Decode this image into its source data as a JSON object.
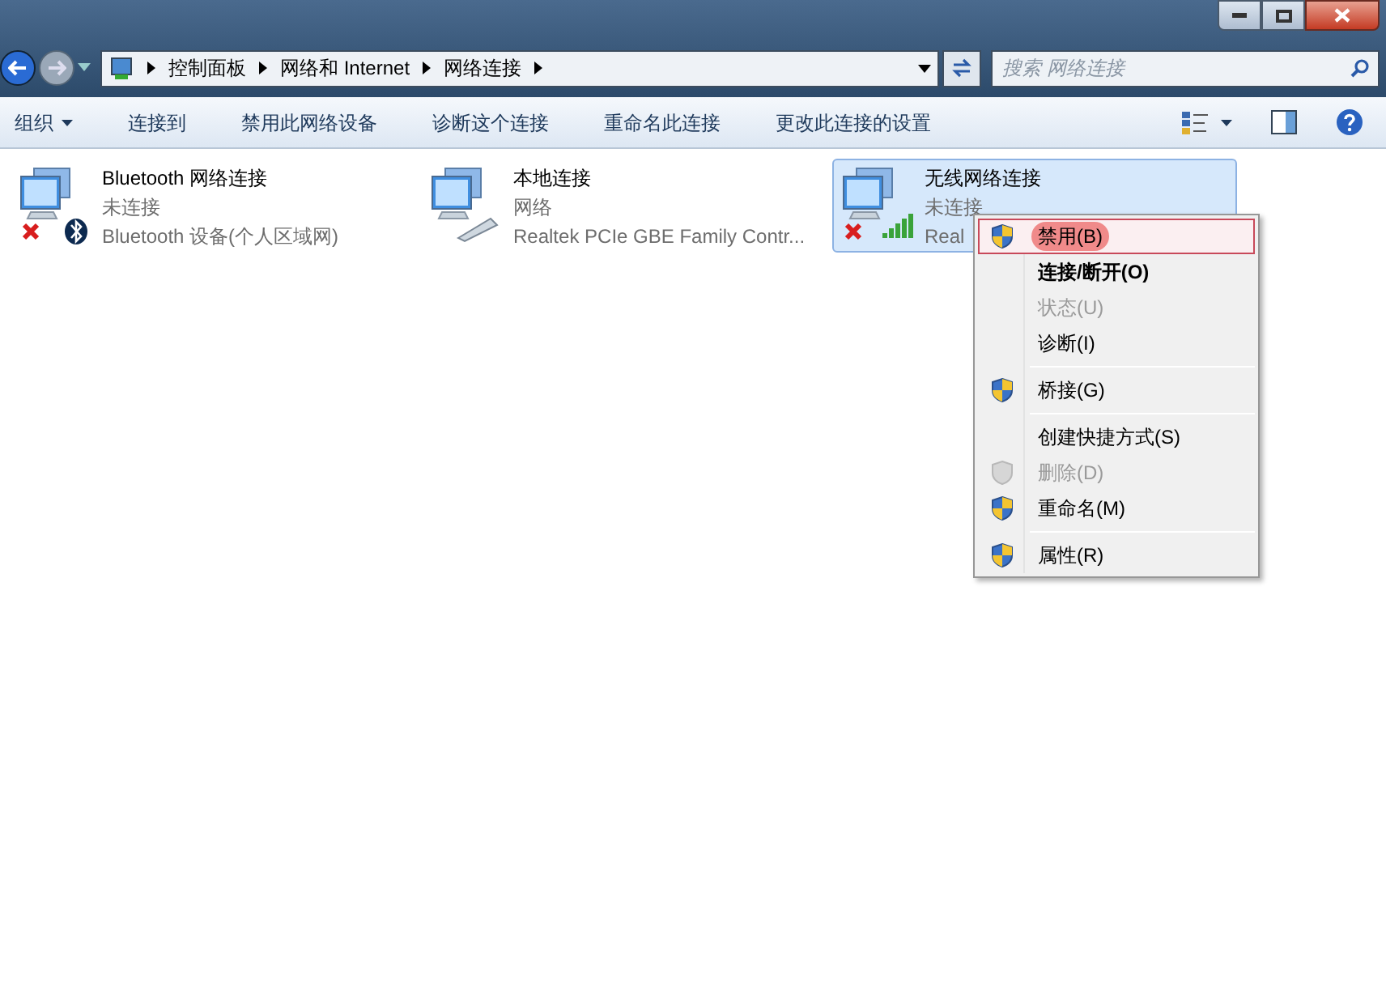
{
  "address_bar": {
    "breadcrumbs": [
      "控制面板",
      "网络和 Internet",
      "网络连接"
    ]
  },
  "search": {
    "placeholder": "搜索 网络连接"
  },
  "toolbar": {
    "items": [
      {
        "label": "组织",
        "dropdown": true
      },
      {
        "label": "连接到",
        "dropdown": false
      },
      {
        "label": "禁用此网络设备",
        "dropdown": false
      },
      {
        "label": "诊断这个连接",
        "dropdown": false
      },
      {
        "label": "重命名此连接",
        "dropdown": false
      },
      {
        "label": "更改此连接的设置",
        "dropdown": false
      }
    ]
  },
  "connections": [
    {
      "kind": "bluetooth",
      "name": "Bluetooth 网络连接",
      "status": "未连接",
      "device": "Bluetooth 设备(个人区域网)",
      "disconnected": true,
      "selected": false
    },
    {
      "kind": "ethernet",
      "name": "本地连接",
      "status": "网络",
      "device": "Realtek PCIe GBE Family Contr...",
      "disconnected": false,
      "selected": false
    },
    {
      "kind": "wifi",
      "name": "无线网络连接",
      "status": "未连接",
      "device": "Real",
      "disconnected": true,
      "selected": true
    }
  ],
  "context_menu": [
    {
      "kind": "shield",
      "label": "禁用(B)",
      "bold": false,
      "disabled": false,
      "selected": true
    },
    {
      "kind": "plain",
      "label": "连接/断开(O)",
      "bold": true,
      "disabled": false,
      "selected": false
    },
    {
      "kind": "plain",
      "label": "状态(U)",
      "bold": false,
      "disabled": true,
      "selected": false
    },
    {
      "kind": "plain",
      "label": "诊断(I)",
      "bold": false,
      "disabled": false,
      "selected": false
    },
    {
      "kind": "separator"
    },
    {
      "kind": "shield",
      "label": "桥接(G)",
      "bold": false,
      "disabled": false,
      "selected": false
    },
    {
      "kind": "separator"
    },
    {
      "kind": "plain",
      "label": "创建快捷方式(S)",
      "bold": false,
      "disabled": false,
      "selected": false
    },
    {
      "kind": "shield",
      "label": "删除(D)",
      "bold": false,
      "disabled": true,
      "selected": false
    },
    {
      "kind": "shield",
      "label": "重命名(M)",
      "bold": false,
      "disabled": false,
      "selected": false
    },
    {
      "kind": "separator"
    },
    {
      "kind": "shield",
      "label": "属性(R)",
      "bold": false,
      "disabled": false,
      "selected": false
    }
  ]
}
